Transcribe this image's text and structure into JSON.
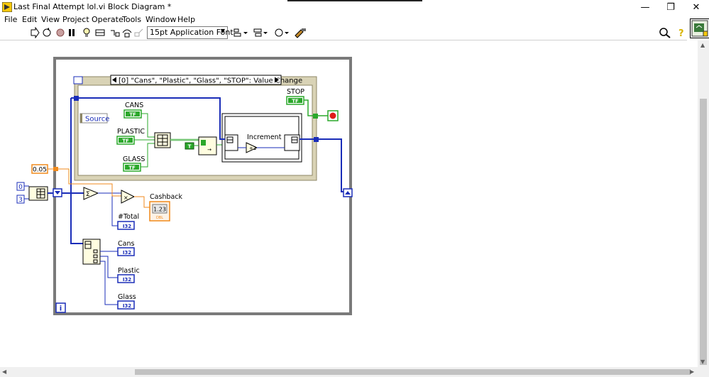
{
  "window": {
    "title": "Last Final Attempt lol.vi Block Diagram *"
  },
  "window_controls": {
    "minimize": "—",
    "restore": "❐",
    "close": "✕"
  },
  "menu": [
    {
      "label": "File"
    },
    {
      "label": "Edit"
    },
    {
      "label": "View"
    },
    {
      "label": "Project"
    },
    {
      "label": "Operate"
    },
    {
      "label": "Tools"
    },
    {
      "label": "Window"
    },
    {
      "label": "Help"
    }
  ],
  "toolbar": {
    "font": "15pt Application Font"
  },
  "diagram": {
    "event_case": "[0] \"Cans\", \"Plastic\", \"Glass\", \"STOP\": Value Change",
    "source_label": "Source",
    "cans_label": "CANS",
    "plastic_label": "PLASTIC",
    "glass_label": "GLASS",
    "tf": "TF",
    "increment_label": "Increment",
    "stop_label": "STOP",
    "constant_rate": "0.05",
    "constant_0": "0",
    "constant_3": "3",
    "cashback_label": "Cashback",
    "cashback_value": "1.23",
    "total_label": "#Total",
    "cans_ind_label": "Cans",
    "plastic_ind_label": "Plastic",
    "glass_ind_label": "Glass",
    "i32": "I32",
    "dbl": "DBL",
    "loop_i": "i",
    "true_const": "T"
  },
  "colors": {
    "loop_border": "#7a7a7a",
    "wire_blue": "#1a2db8",
    "wire_green": "#2ba82b",
    "wire_orange": "#f08a1c",
    "event_frame": "#c7c1a4"
  }
}
